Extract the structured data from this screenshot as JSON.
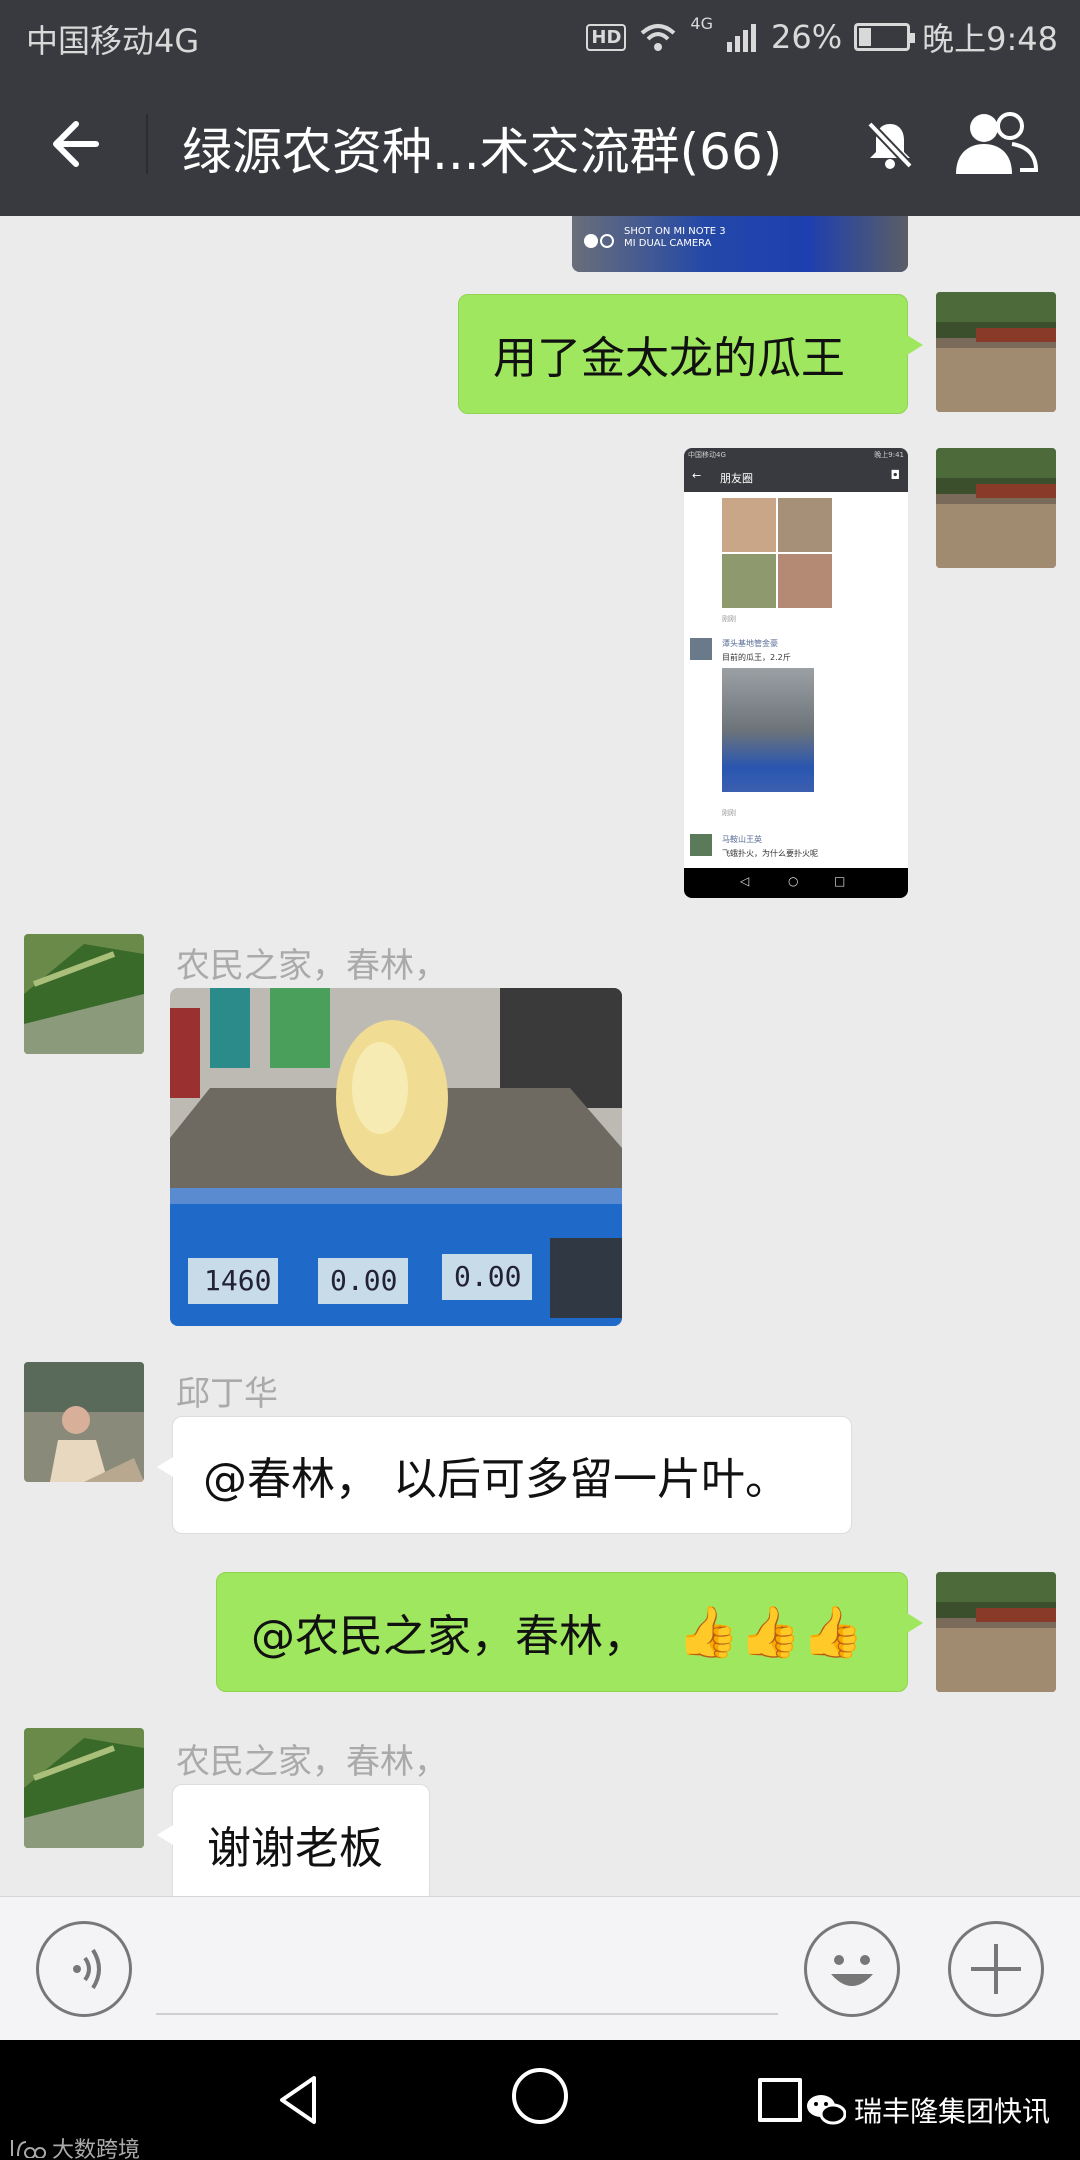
{
  "status_bar": {
    "carrier": "中国移动4G",
    "hd": "HD",
    "network": "4G",
    "battery": "26%",
    "battery_level": 0.26,
    "time": "晚上9:48"
  },
  "header": {
    "title": "绿源农资种...术交流群(66)"
  },
  "messages": [
    {
      "type": "image",
      "side": "right",
      "caption": "SHOT ON MI NOTE 3\nMI DUAL CAMERA"
    },
    {
      "type": "text",
      "side": "right",
      "text": "用了金太龙的瓜王"
    },
    {
      "type": "image",
      "side": "right",
      "subject": "moments-screenshot",
      "inner": {
        "carrier": "中国移动4G",
        "time": "晚上9:41",
        "title": "朋友圈",
        "post1_time": "刚刚",
        "post2_name": "潭头基地管金豪",
        "post2_text": "目前的瓜王，2.2斤",
        "post2_time": "刚刚",
        "post3_name": "马鞍山王英",
        "post3_text": "飞蛾扑火，为什么要扑火呢"
      }
    },
    {
      "type": "image",
      "side": "left",
      "sender": "农民之家，春林，",
      "scale_readouts": [
        "1460",
        "0.00",
        "0.00"
      ]
    },
    {
      "type": "text",
      "side": "left",
      "sender": "邱丁华",
      "text": "@春林， 以后可多留一片叶。"
    },
    {
      "type": "text",
      "side": "right",
      "text": "@农民之家，春林，",
      "emoji": [
        "thumbs-up-icon",
        "thumbs-up-icon",
        "thumbs-up-icon"
      ]
    },
    {
      "type": "text",
      "side": "left",
      "sender": "农民之家，春林，",
      "text": "谢谢老板"
    }
  ],
  "watermarks": {
    "right": "瑞丰隆集团快讯",
    "left": "大数跨境"
  },
  "colors": {
    "titlebar": "#393a3f",
    "sent_bubble": "#9fe75e",
    "chat_bg": "#ebebeb"
  }
}
